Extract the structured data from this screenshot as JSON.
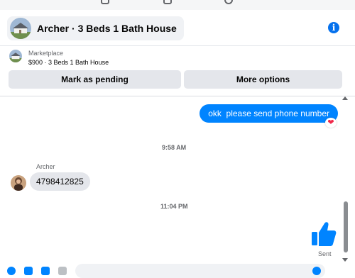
{
  "header": {
    "title": "Archer · 3 Beds 1 Bath House",
    "info_icon": "info-icon"
  },
  "marketplace": {
    "label": "Marketplace",
    "item": "$900 · 3 Beds 1 Bath House",
    "pending_button": "Mark as pending",
    "more_button": "More options"
  },
  "messages": {
    "outgoing_text": "okk  please send phone number",
    "reaction": "❤",
    "timestamp_1": "9:58 AM",
    "sender_name": "Archer",
    "incoming_text": "4798412825",
    "timestamp_2": "11:04 PM",
    "like_icon": "thumbs-up-icon",
    "sent_status": "Sent"
  },
  "colors": {
    "accent": "#0084ff",
    "bubble_gray": "#e4e6eb",
    "heart": "#f02849"
  }
}
